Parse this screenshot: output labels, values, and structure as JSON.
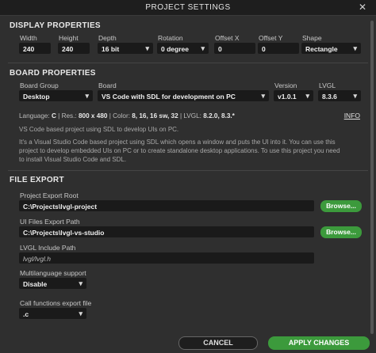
{
  "window": {
    "title": "PROJECT SETTINGS",
    "close_glyph": "✕"
  },
  "display": {
    "heading": "DISPLAY PROPERTIES",
    "width_label": "Width",
    "width_value": "240",
    "height_label": "Height",
    "height_value": "240",
    "depth_label": "Depth",
    "depth_value": "16 bit",
    "rotation_label": "Rotation",
    "rotation_value": "0 degree",
    "offset_x_label": "Offset X",
    "offset_x_value": "0",
    "offset_y_label": "Offset Y",
    "offset_y_value": "0",
    "shape_label": "Shape",
    "shape_value": "Rectangle"
  },
  "board": {
    "heading": "BOARD PROPERTIES",
    "group_label": "Board Group",
    "group_value": "Desktop",
    "board_label": "Board",
    "board_value": "VS Code with SDL for development on PC",
    "version_label": "Version",
    "version_value": "v1.0.1",
    "lvgl_label": "LVGL",
    "lvgl_value": "8.3.6",
    "info": {
      "language_label": "Language:",
      "language_value": "C",
      "res_label": "Res.:",
      "res_value": "800 x 480",
      "color_label": "Color:",
      "color_value": "8, 16, 16 sw, 32",
      "lvgl_label": "LVGL:",
      "lvgl_value": "8.2.0, 8.3.*",
      "link": "INFO"
    },
    "desc_1": "VS Code based project using SDL to develop UIs on PC.",
    "desc_2": "It's a Visual Studio Code based project using SDL which opens a window and puts the UI into it. You can use this",
    "desc_3": "project to develop embedded UIs on PC or to create standalone desktop applications. To use this project you need",
    "desc_4": "to install Visual Studio Code and SDL."
  },
  "file_export": {
    "heading": "FILE EXPORT",
    "project_root_label": "Project Export Root",
    "project_root_value": "C:\\Projects\\lvgl-project",
    "ui_path_label": "UI Files Export Path",
    "ui_path_value": "C:\\Projects\\lvgl-vs-studio",
    "browse_label": "Browse...",
    "include_label": "LVGL Include Path",
    "include_value": "lvgl/lvgl.h",
    "multilang_label": "Multilanguage support",
    "multilang_value": "Disable",
    "call_export_label": "Call functions export file",
    "call_export_value": ".c"
  },
  "footer": {
    "cancel_label": "CANCEL",
    "apply_label": "APPLY CHANGES"
  }
}
